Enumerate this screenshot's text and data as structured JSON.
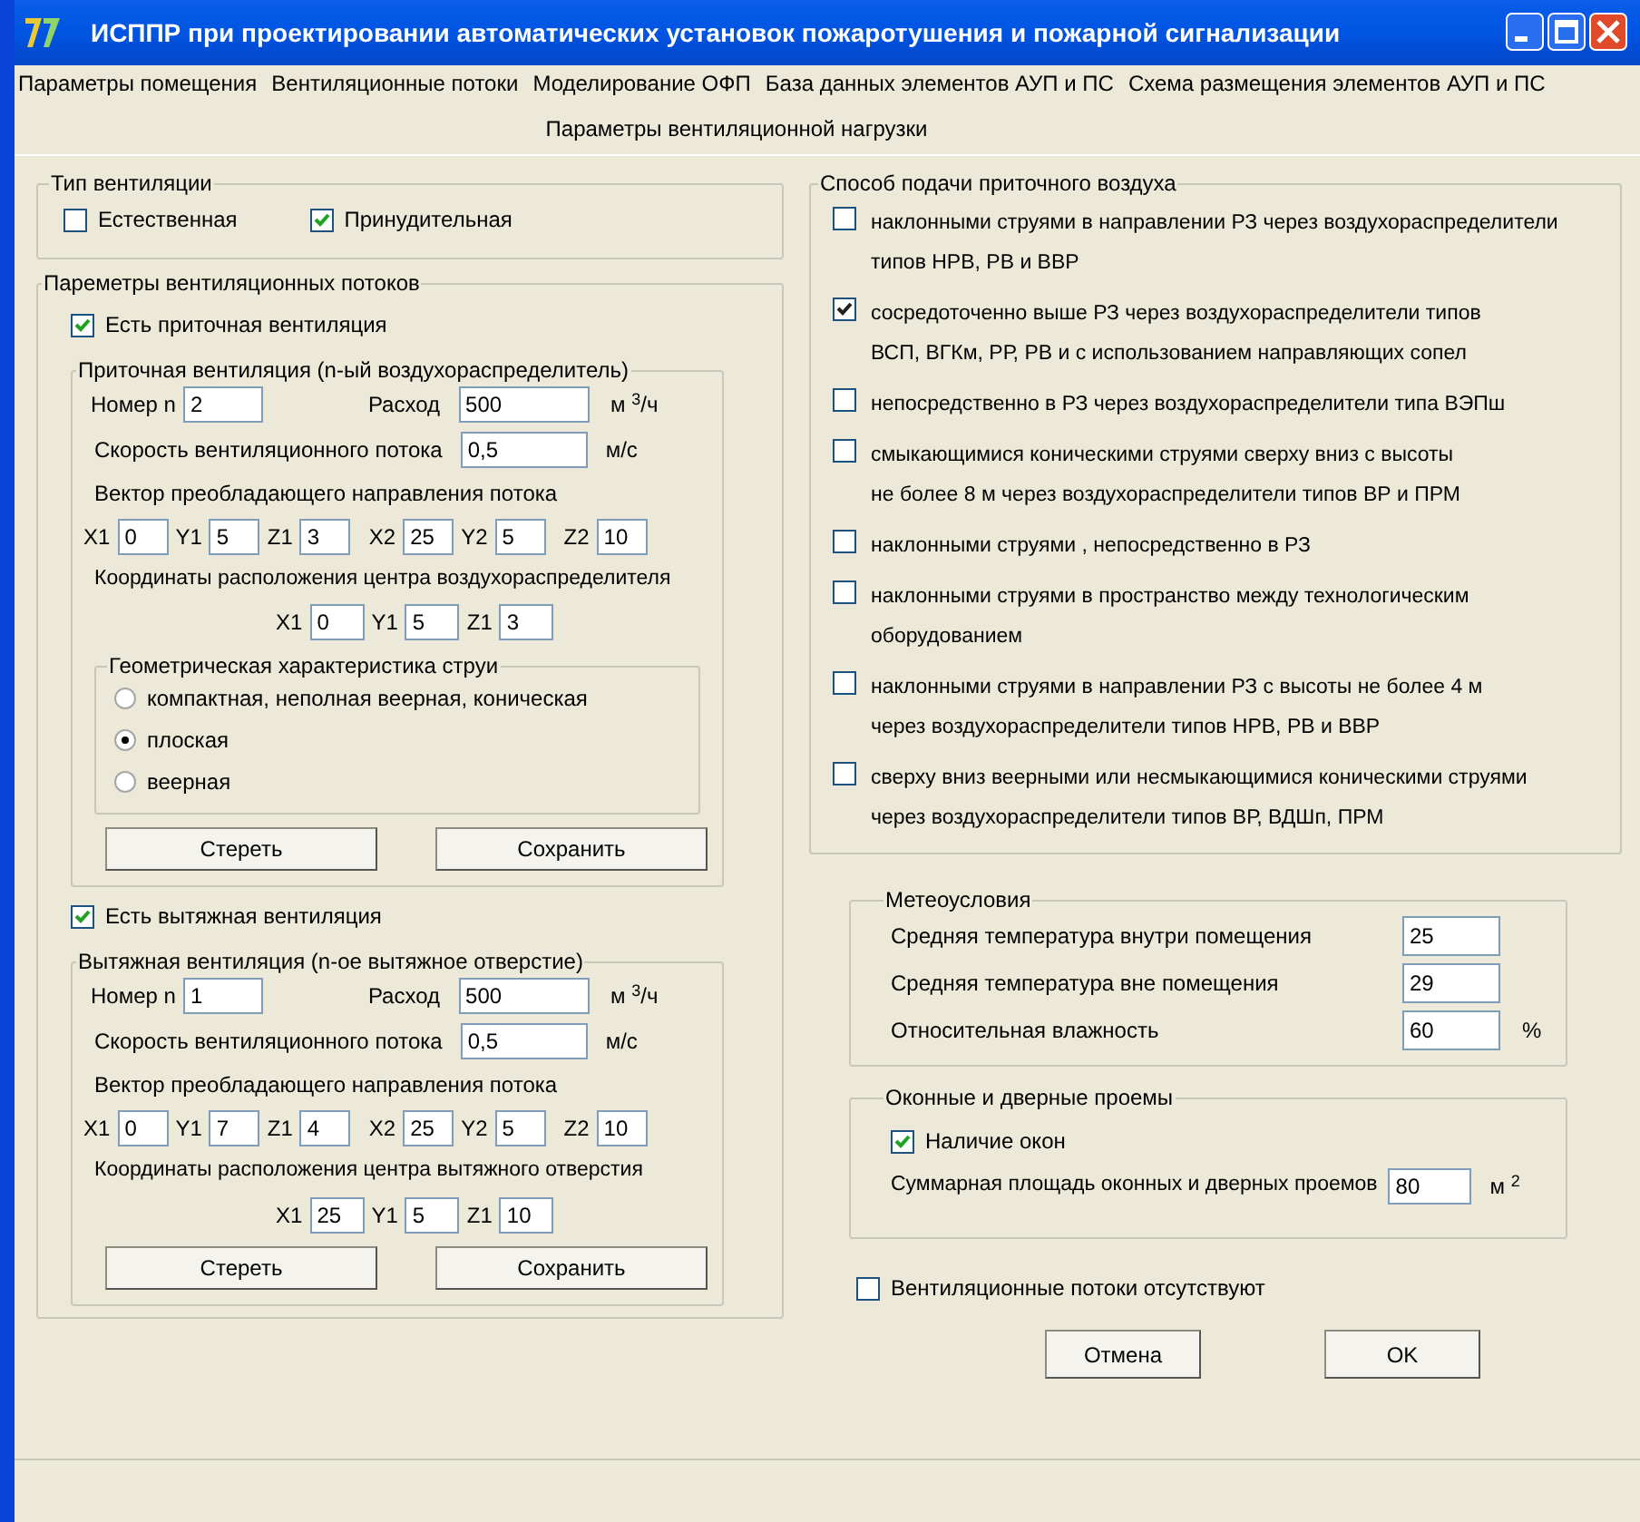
{
  "window": {
    "title": "ИСППР при проектировании автоматических установок пожаротушения и пожарной сигнализации"
  },
  "menu": [
    "Параметры помещения",
    "Вентиляционные потоки",
    "Моделирование ОФП",
    "База данных элементов АУП и ПС",
    "Схема размещения элементов АУП и ПС"
  ],
  "header": "Параметры вентиляционной нагрузки",
  "ventilation_type": {
    "title": "Тип вентиляции",
    "options": [
      {
        "label": "Естественная",
        "checked": false
      },
      {
        "label": "Принудительная",
        "checked": true
      }
    ]
  },
  "flows": {
    "title": "Пареметры вентиляционных потоков",
    "sections": [
      {
        "checkbox": {
          "label": "Есть приточная вентиляция",
          "checked": true
        },
        "title": "Приточная вентиляция (n-ый воздухораспределитель)",
        "number_label": "Номер n",
        "number": "2",
        "rate_label": "Расход",
        "rate": "500",
        "rate_unit": "м $^{3}$/ч",
        "speed_label": "Скорость вентиляционного потока",
        "speed": "0,5",
        "speed_unit": "м/с",
        "vector_label": "Вектор  преобладающего направления потока",
        "vector": [
          {
            "label": "X1",
            "value": "0"
          },
          {
            "label": "Y1",
            "value": "5"
          },
          {
            "label": "Z1",
            "value": "3"
          },
          {
            "label": "X2",
            "value": "25"
          },
          {
            "label": "Y2",
            "value": "5"
          },
          {
            "label": "Z2",
            "value": "10"
          }
        ],
        "center_label": "Координаты расположения центра воздухораспределителя",
        "center": [
          {
            "label": "X1",
            "value": "0"
          },
          {
            "label": "Y1",
            "value": "5"
          },
          {
            "label": "Z1",
            "value": "3"
          }
        ],
        "jet": {
          "title": "Геометрическая характеристика струи",
          "options": [
            {
              "label": "компактная, неполная веерная, коническая",
              "selected": false
            },
            {
              "label": "плоская",
              "selected": true
            },
            {
              "label": "веерная",
              "selected": false
            }
          ]
        },
        "buttons": [
          "Стереть",
          "Сохранить"
        ]
      },
      {
        "checkbox": {
          "label": "Есть вытяжная вентиляция",
          "checked": true
        },
        "title": "Вытяжная вентиляция (n-ое вытяжное отверстие)",
        "number_label": "Номер n",
        "number": "1",
        "rate_label": "Расход",
        "rate": "500",
        "rate_unit": "м $^{3}$/ч",
        "speed_label": "Скорость вентиляционного потока",
        "speed": "0,5",
        "speed_unit": "м/с",
        "vector_label": "Вектор  преобладающего направления потока",
        "vector": [
          {
            "label": "X1",
            "value": "0"
          },
          {
            "label": "Y1",
            "value": "7"
          },
          {
            "label": "Z1",
            "value": "4"
          },
          {
            "label": "X2",
            "value": "25"
          },
          {
            "label": "Y2",
            "value": "5"
          },
          {
            "label": "Z2",
            "value": "10"
          }
        ],
        "center_label": "Координаты расположения центра вытяжного отверстия",
        "center": [
          {
            "label": "X1",
            "value": "25"
          },
          {
            "label": "Y1",
            "value": "5"
          },
          {
            "label": "Z1",
            "value": "10"
          }
        ],
        "buttons": [
          "Стереть",
          "Сохранить"
        ]
      }
    ]
  },
  "supply_method": {
    "title": "Способ подачи приточного воздуха",
    "options": [
      {
        "lines": [
          "наклонными струями в направлении РЗ через воздухораспределители",
          "типов НРВ, РВ и ВВР"
        ],
        "checked": false
      },
      {
        "lines": [
          "сосредоточенно выше РЗ через воздухораспределители типов",
          "ВСП, ВГКм, РР, РВ и с использованием направляющих сопел"
        ],
        "checked": true
      },
      {
        "lines": [
          "непосредственно в РЗ через воздухораспределители типа ВЭПш"
        ],
        "checked": false
      },
      {
        "lines": [
          "смыкающимися коническими струями сверху вниз с высоты",
          "не более 8 м через воздухораспределители типов ВР и ПРМ"
        ],
        "checked": false
      },
      {
        "lines": [
          "наклонными струями , непосредственно в РЗ"
        ],
        "checked": false
      },
      {
        "lines": [
          "наклонными струями в пространство между технологическим",
          "оборудованием"
        ],
        "checked": false
      },
      {
        "lines": [
          "наклонными струями в направлении РЗ с высоты не более 4 м",
          "через воздухораспределители типов НРВ, РВ и ВВР"
        ],
        "checked": false
      },
      {
        "lines": [
          "сверху вниз веерными или несмыкающимися коническими струями",
          "через воздухораспределители типов ВР, ВДШп, ПРМ"
        ],
        "checked": false
      }
    ]
  },
  "weather": {
    "title": "Метеоусловия",
    "rows": [
      {
        "label": "Средняя температура внутри помещения",
        "value": "25"
      },
      {
        "label": "Средняя температура вне помещения",
        "value": "29"
      },
      {
        "label": "Относительная влажность",
        "value": "60",
        "unit": "%"
      }
    ]
  },
  "openings": {
    "title": "Оконные  и дверные проемы",
    "checkbox": {
      "label": "Наличие окон",
      "checked": true
    },
    "area_label": "Суммарная площадь оконных и дверных проемов",
    "area": "80",
    "area_unit": "м $^{2}$"
  },
  "no_flows": {
    "label": "Вентиляционные потоки отсутствуют",
    "checked": false
  },
  "buttons": [
    "Отмена",
    "OK"
  ]
}
